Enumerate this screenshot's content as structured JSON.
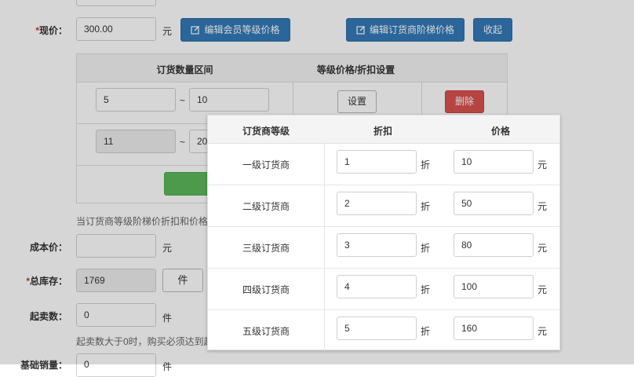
{
  "form": {
    "price": {
      "required_mark": "*",
      "label": "现价：",
      "value": "300.00",
      "unit": "元"
    },
    "buttons": {
      "edit_member": "编辑会员等级价格",
      "edit_distributor": "编辑订货商阶梯价格",
      "collapse": "收起"
    },
    "tier_table": {
      "headers": [
        "订货数量区间",
        "等级价格/折扣设置"
      ],
      "rows": [
        {
          "from": "5",
          "to": "10",
          "setting_label": "设置",
          "delete_label": "删除"
        },
        {
          "from": "11",
          "to": "20"
        }
      ],
      "range_sep": "~"
    },
    "tier_hint": "当订货商等级阶梯价折扣和价格",
    "cost_price": {
      "label": "成本价：",
      "value": "",
      "unit": "元"
    },
    "total_stock": {
      "required_mark": "*",
      "label": "总库存：",
      "value": "1769",
      "unit_button": "件"
    },
    "min_sale": {
      "label": "起卖数：",
      "value": "0",
      "unit": "件"
    },
    "min_sale_hint": "起卖数大于0时，购买必须达到起",
    "base_sales": {
      "label": "基础销量：",
      "value": "0",
      "unit": "件"
    }
  },
  "popup": {
    "headers": [
      "订货商等级",
      "折扣",
      "价格"
    ],
    "discount_unit": "折",
    "price_unit": "元",
    "rows": [
      {
        "level": "一级订货商",
        "discount": "1",
        "price": "10"
      },
      {
        "level": "二级订货商",
        "discount": "2",
        "price": "50"
      },
      {
        "level": "三级订货商",
        "discount": "3",
        "price": "80"
      },
      {
        "level": "四级订货商",
        "discount": "4",
        "price": "100"
      },
      {
        "level": "五级订货商",
        "discount": "5",
        "price": "160"
      }
    ]
  },
  "colors": {
    "primary": "#337ab7",
    "danger": "#d9534f",
    "success": "#5cb85c",
    "required": "#d0392b"
  }
}
